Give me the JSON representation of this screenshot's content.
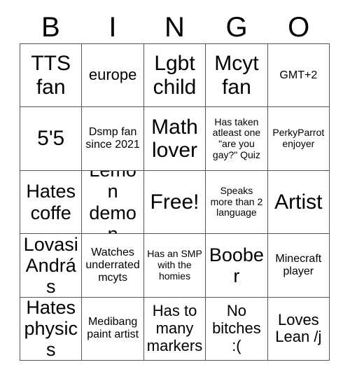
{
  "card": {
    "header_letters": [
      "B",
      "I",
      "N",
      "G",
      "O"
    ],
    "rows": [
      [
        {
          "text": "TTS fan",
          "size": "xl"
        },
        {
          "text": "europe",
          "size": "md"
        },
        {
          "text": "Lgbt child",
          "size": "xl"
        },
        {
          "text": "Mcyt fan",
          "size": "xl"
        },
        {
          "text": "GMT+2",
          "size": "sm"
        }
      ],
      [
        {
          "text": "5'5",
          "size": "xl"
        },
        {
          "text": "Dsmp fan since 2021",
          "size": "sm"
        },
        {
          "text": "Math lover",
          "size": "xl"
        },
        {
          "text": "Has taken atleast one \"are you gay?\" Quiz",
          "size": "xs"
        },
        {
          "text": "PerkyParrot enjoyer",
          "size": "xs"
        }
      ],
      [
        {
          "text": "Hates coffe",
          "size": "lg"
        },
        {
          "text": "Lemon demon",
          "size": "lg"
        },
        {
          "text": "Free!",
          "size": "xl"
        },
        {
          "text": "Speaks more than 2 language",
          "size": "xs"
        },
        {
          "text": "Artist",
          "size": "xl"
        }
      ],
      [
        {
          "text": "Lovasi András",
          "size": "lg"
        },
        {
          "text": "Watches underrated mcyts",
          "size": "sm"
        },
        {
          "text": "Has an SMP with the homies",
          "size": "xs"
        },
        {
          "text": "Boober",
          "size": "lg"
        },
        {
          "text": "Minecraft player",
          "size": "sm"
        }
      ],
      [
        {
          "text": "Hates physics",
          "size": "lg"
        },
        {
          "text": "Medibang paint artist",
          "size": "sm"
        },
        {
          "text": "Has to many markers",
          "size": "md"
        },
        {
          "text": "No bitches :(",
          "size": "md"
        },
        {
          "text": "Loves Lean /j",
          "size": "md"
        }
      ]
    ]
  },
  "colors": {
    "background": "#ffffff",
    "text": "#000000",
    "border": "#555555"
  }
}
